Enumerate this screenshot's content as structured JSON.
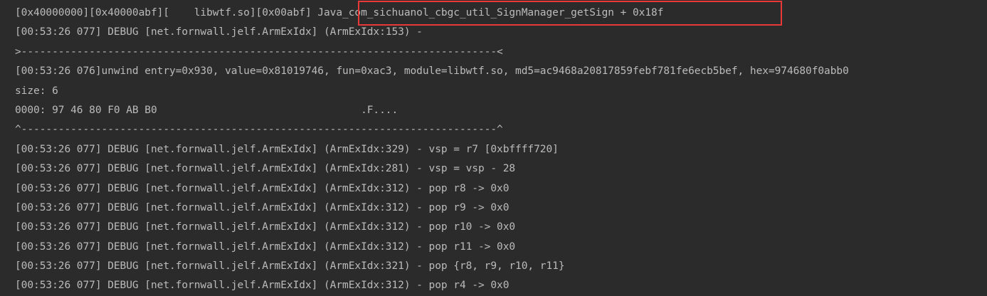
{
  "console": {
    "lines": [
      "[0x40000000][0x40000abf][    libwtf.so][0x00abf] Java_com_sichuanol_cbgc_util_SignManager_getSign + 0x18f",
      "[00:53:26 077] DEBUG [net.fornwall.jelf.ArmExIdx] (ArmExIdx:153) -",
      ">-----------------------------------------------------------------------------<",
      "[00:53:26 076]unwind entry=0x930, value=0x81019746, fun=0xac3, module=libwtf.so, md5=ac9468a20817859febf781fe6ecb5bef, hex=974680f0abb0",
      "size: 6",
      "0000: 97 46 80 F0 AB B0                                 .F....",
      "^-----------------------------------------------------------------------------^",
      "[00:53:26 077] DEBUG [net.fornwall.jelf.ArmExIdx] (ArmExIdx:329) - vsp = r7 [0xbffff720]",
      "[00:53:26 077] DEBUG [net.fornwall.jelf.ArmExIdx] (ArmExIdx:281) - vsp = vsp - 28",
      "[00:53:26 077] DEBUG [net.fornwall.jelf.ArmExIdx] (ArmExIdx:312) - pop r8 -> 0x0",
      "[00:53:26 077] DEBUG [net.fornwall.jelf.ArmExIdx] (ArmExIdx:312) - pop r9 -> 0x0",
      "[00:53:26 077] DEBUG [net.fornwall.jelf.ArmExIdx] (ArmExIdx:312) - pop r10 -> 0x0",
      "[00:53:26 077] DEBUG [net.fornwall.jelf.ArmExIdx] (ArmExIdx:312) - pop r11 -> 0x0",
      "[00:53:26 077] DEBUG [net.fornwall.jelf.ArmExIdx] (ArmExIdx:321) - pop {r8, r9, r10, r11}",
      "[00:53:26 077] DEBUG [net.fornwall.jelf.ArmExIdx] (ArmExIdx:312) - pop r4 -> 0x0"
    ]
  },
  "colors": {
    "background": "#2b2b2b",
    "text": "#bbbbbb",
    "highlight_box": "#e8383a"
  }
}
